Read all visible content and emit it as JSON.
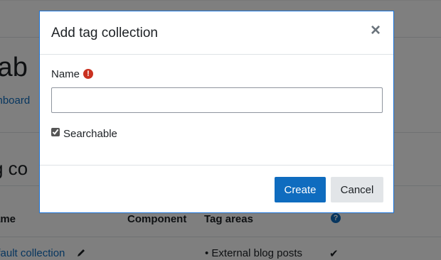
{
  "background": {
    "heading": "tab",
    "breadcrumb_link": "shboard",
    "subheading": "g co",
    "table": {
      "headers": [
        "ame",
        "Component",
        "Tag areas"
      ],
      "help_icon": "question-icon",
      "row": {
        "name": "efault collection",
        "edit_icon": "pencil-icon",
        "tag_area": "External blog posts",
        "searchable_icon": "check-icon"
      }
    }
  },
  "modal": {
    "title": "Add tag collection",
    "close_icon": "×",
    "name_label": "Name",
    "required_icon": "!",
    "name_value": "",
    "searchable_label": "Searchable",
    "searchable_checked": true,
    "create_label": "Create",
    "cancel_label": "Cancel"
  },
  "colors": {
    "primary": "#0f6cbf",
    "required": "#ca3120",
    "modal_border": "#1a73d9"
  }
}
